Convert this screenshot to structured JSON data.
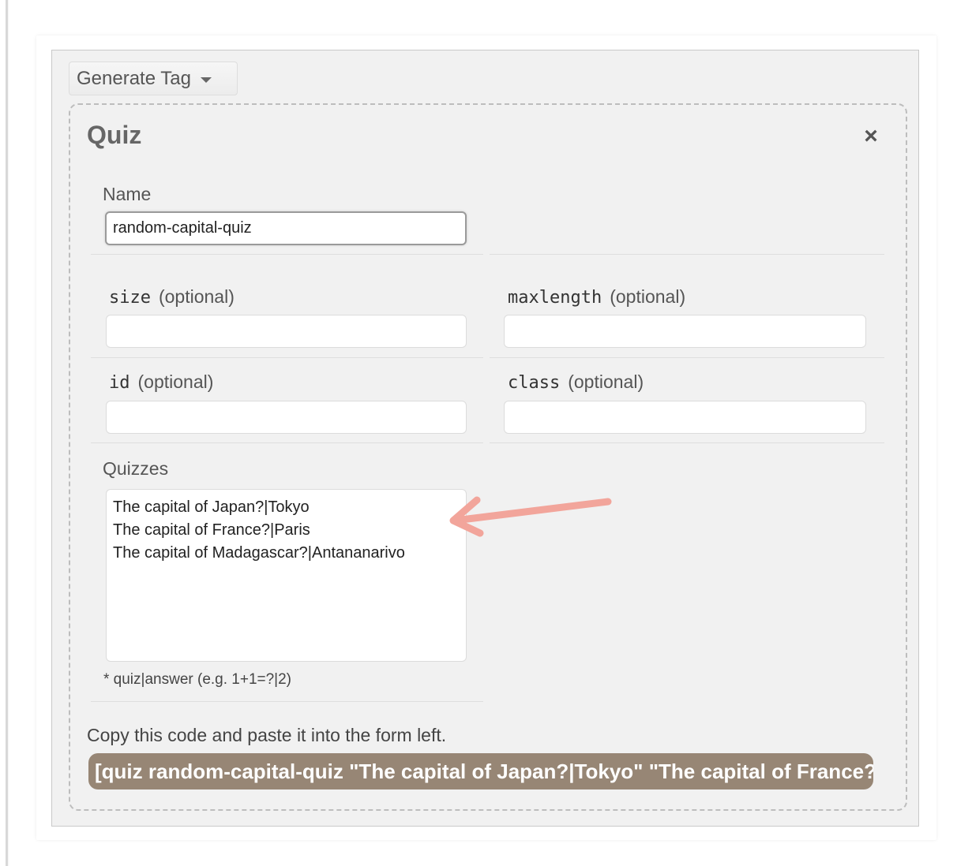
{
  "toolbar": {
    "generate_tag_label": "Generate Tag"
  },
  "dialog": {
    "title": "Quiz",
    "close_symbol": "×"
  },
  "fields": {
    "name": {
      "label": "Name",
      "value": "random-capital-quiz"
    },
    "size": {
      "attr": "size",
      "optional_label": "(optional)",
      "value": ""
    },
    "maxlength": {
      "attr": "maxlength",
      "optional_label": "(optional)",
      "value": ""
    },
    "id": {
      "attr": "id",
      "optional_label": "(optional)",
      "value": ""
    },
    "class": {
      "attr": "class",
      "optional_label": "(optional)",
      "value": ""
    },
    "quizzes": {
      "label": "Quizzes",
      "lines": [
        "The capital of Japan?|Tokyo",
        "The capital of France?|Paris",
        "The capital of Madagascar?|Antananarivo"
      ],
      "hint": "* quiz|answer (e.g. 1+1=?|2)"
    }
  },
  "code": {
    "instruction": "Copy this code and paste it into the form left.",
    "value": "[quiz random-capital-quiz \"The capital of Japan?|Tokyo\" \"The capital of France?|Paris\" \"The capital of Madagascar?|Antananarivo\"]"
  },
  "colors": {
    "panel_bg": "#f1f1f1",
    "code_bar_bg": "#978675",
    "arrow": "#f2a59b"
  },
  "icons": {
    "dropdown": "chevron-down-icon",
    "close": "close-icon",
    "annotation": "arrow-left-icon"
  }
}
